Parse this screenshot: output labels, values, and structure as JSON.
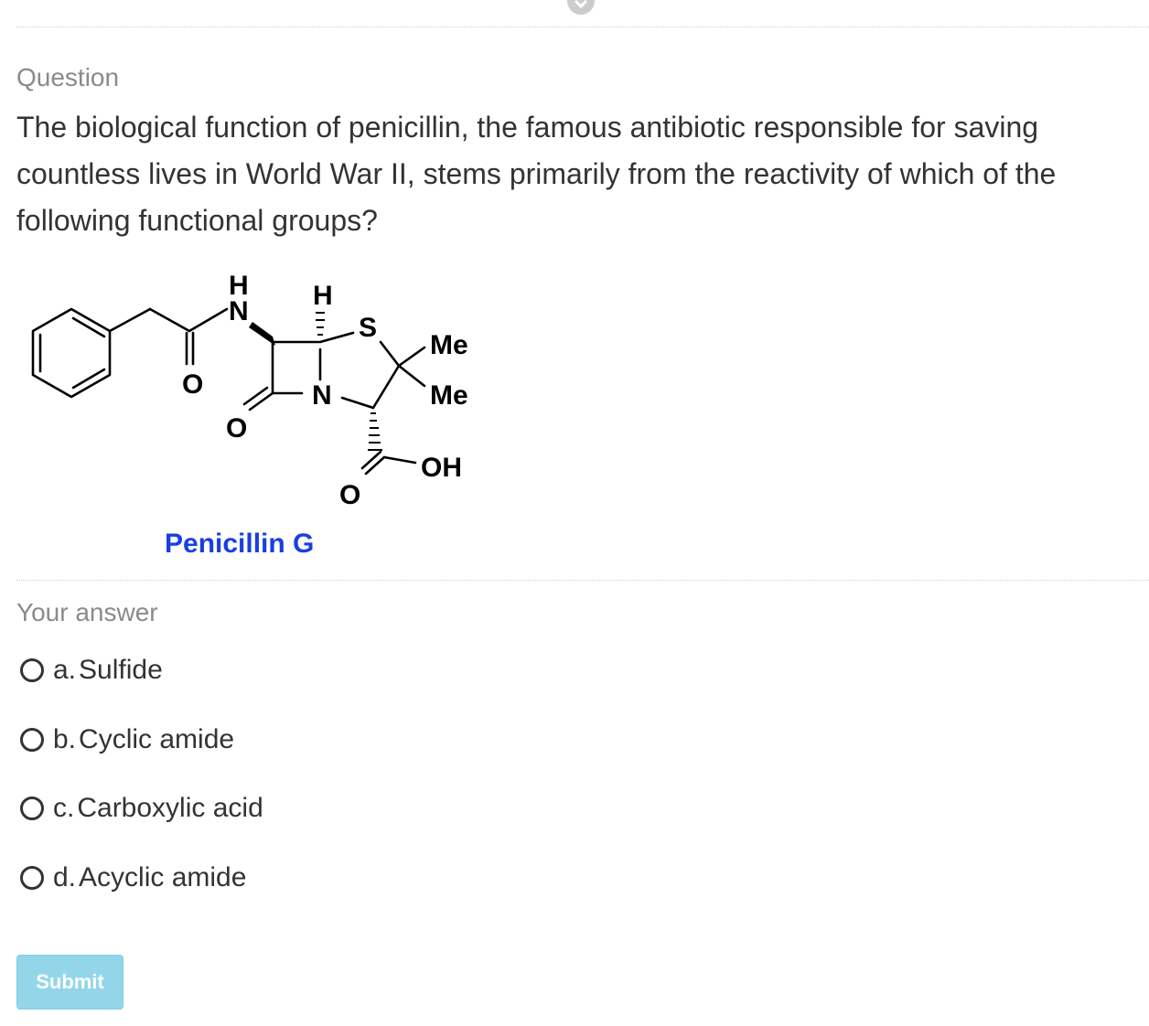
{
  "question": {
    "section_label": "Question",
    "text": "The biological function of penicillin, the famous antibiotic responsible for saving countless lives in World War II, stems primarily from the reactivity of which of the following functional groups?",
    "figure": {
      "atom_labels": {
        "h_amide": "H",
        "n_amide": "N",
        "h_stereo": "H",
        "sulfur": "S",
        "methyl_1": "Me",
        "methyl_2": "Me",
        "o_amide": "O",
        "n_ring": "N",
        "o_lactam": "O",
        "hydroxyl": "OH",
        "o_acid": "O"
      },
      "caption": "Penicillin G",
      "caption_color": "#1a3fe0"
    }
  },
  "answer": {
    "section_label": "Your answer",
    "options": [
      {
        "letter": "a.",
        "text": "Sulfide"
      },
      {
        "letter": "b.",
        "text": "Cyclic amide"
      },
      {
        "letter": "c.",
        "text": "Carboxylic acid"
      },
      {
        "letter": "d.",
        "text": "Acyclic amide"
      }
    ]
  },
  "submit_label": "Submit",
  "colors": {
    "text": "#333333",
    "muted": "#8a8a8a",
    "submit_bg": "#93d6ea",
    "divider": "#cfcfcf"
  },
  "icons": {
    "top_toggle": "chevron-down-icon",
    "option_marker": "radio-circle-icon"
  }
}
